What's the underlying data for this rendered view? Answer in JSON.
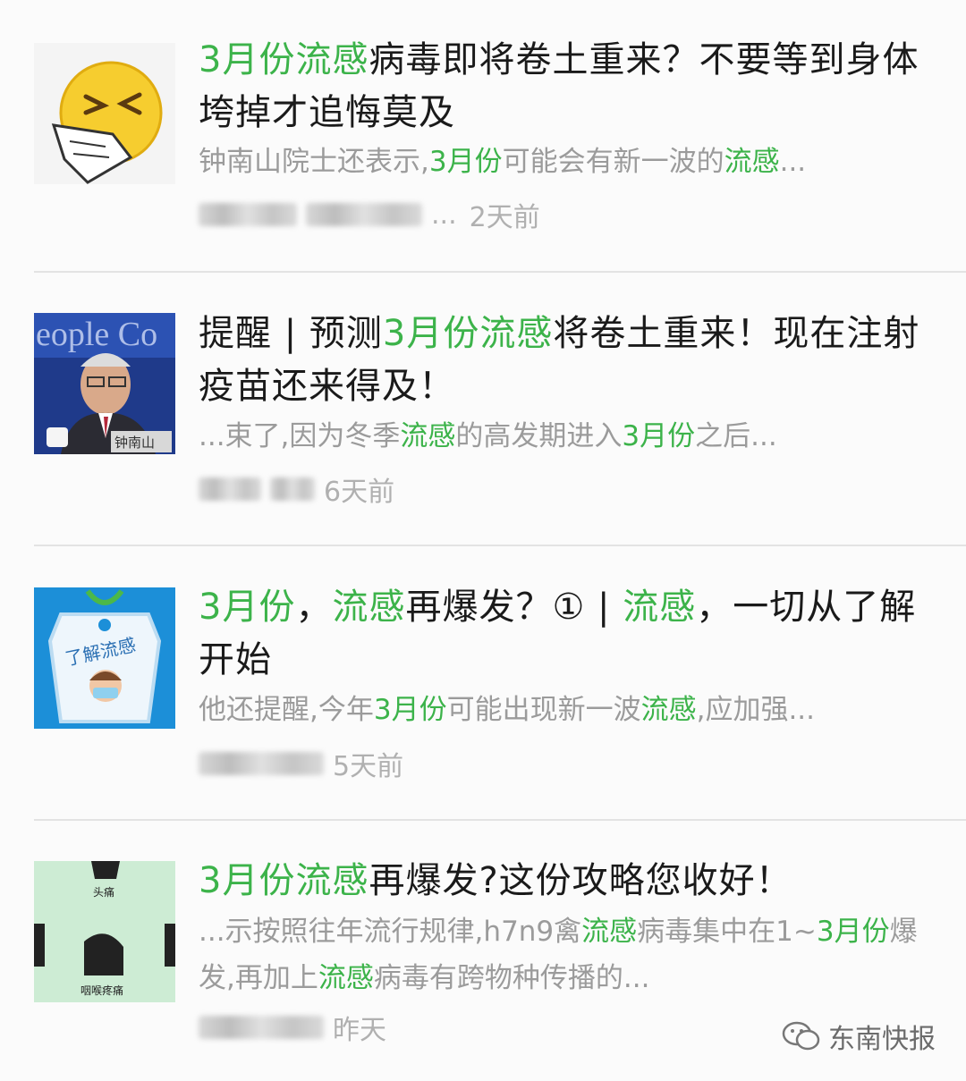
{
  "articles": [
    {
      "title": [
        {
          "t": "3月份流感",
          "h": true
        },
        {
          "t": "病毒即将卷土重来？不要等到身体垮掉才追悔莫及",
          "h": false
        }
      ],
      "summary": [
        {
          "t": "钟南山院士还表示,",
          "h": false
        },
        {
          "t": "3月份",
          "h": true
        },
        {
          "t": "可能会有新一波的",
          "h": false
        },
        {
          "t": "流感",
          "h": true
        },
        {
          "t": "...",
          "h": false
        }
      ],
      "time": "2天前",
      "thumb_icon": "sneezing-face-icon"
    },
    {
      "title": [
        {
          "t": "提醒 | 预测",
          "h": false
        },
        {
          "t": "3月份流感",
          "h": true
        },
        {
          "t": "将卷土重来！现在注射疫苗还来得及！",
          "h": false
        }
      ],
      "summary": [
        {
          "t": "...束了,因为冬季",
          "h": false
        },
        {
          "t": "流感",
          "h": true
        },
        {
          "t": "的高发期进入",
          "h": false
        },
        {
          "t": "3月份",
          "h": true
        },
        {
          "t": "之后...",
          "h": false
        }
      ],
      "time": "6天前",
      "thumb_caption": "钟南山"
    },
    {
      "title": [
        {
          "t": "3月份",
          "h": true
        },
        {
          "t": "，",
          "h": false
        },
        {
          "t": "流感",
          "h": true
        },
        {
          "t": "再爆发？① | ",
          "h": false
        },
        {
          "t": "流感",
          "h": true
        },
        {
          "t": "，一切从了解开始",
          "h": false
        }
      ],
      "summary": [
        {
          "t": "他还提醒,今年",
          "h": false
        },
        {
          "t": "3月份",
          "h": true
        },
        {
          "t": "可能出现新一波",
          "h": false
        },
        {
          "t": "流感",
          "h": true
        },
        {
          "t": ",应加强...",
          "h": false
        }
      ],
      "time": "5天前",
      "thumb_caption": "了解流感"
    },
    {
      "title": [
        {
          "t": "3月份流感",
          "h": true
        },
        {
          "t": "再爆发?这份攻略您收好！",
          "h": false
        }
      ],
      "summary": [
        {
          "t": "...示按照往年流行规律,h7n9禽",
          "h": false
        },
        {
          "t": "流感",
          "h": true
        },
        {
          "t": "病毒集中在1~",
          "h": false
        },
        {
          "t": "3月份",
          "h": true
        },
        {
          "t": "爆发,再加上",
          "h": false
        },
        {
          "t": "流感",
          "h": true
        },
        {
          "t": "病毒有跨物种传播的...",
          "h": false
        }
      ],
      "time": "昨天",
      "thumb_labels": [
        "头痛",
        "咽喉疼痛"
      ]
    }
  ],
  "watermark": "东南快报",
  "colors": {
    "highlight": "#3cb34a",
    "summary": "#9b9b9b",
    "meta": "#b0b0b0"
  }
}
